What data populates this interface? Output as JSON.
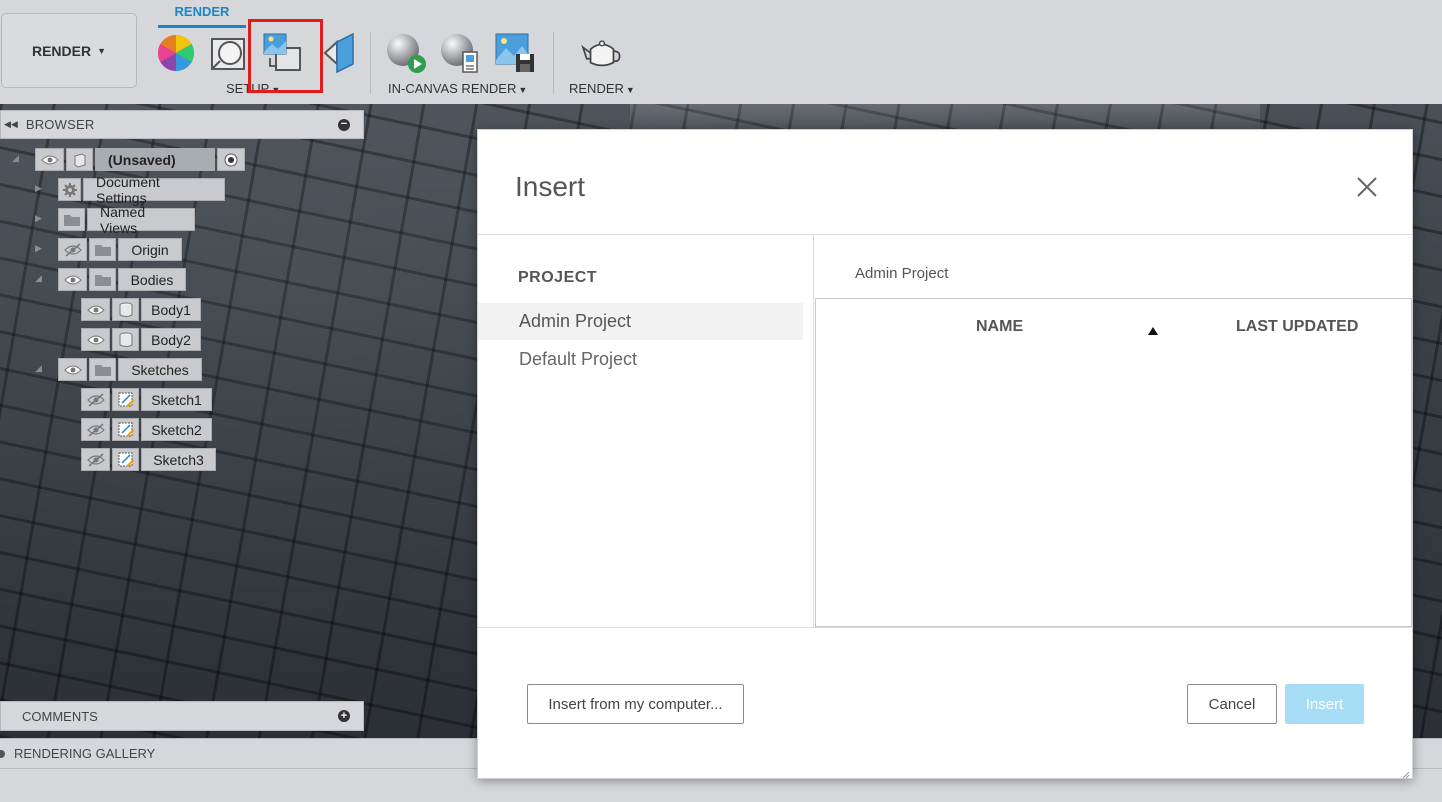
{
  "toolbar": {
    "workspace_label": "RENDER",
    "active_tab": "RENDER",
    "groups": {
      "setup": "SETUP",
      "in_canvas_render": "IN-CANVAS RENDER",
      "render": "RENDER"
    },
    "tools": [
      "appearance-icon",
      "scene-settings-icon",
      "texture-map-icon",
      "decal-icon",
      "in-canvas-render-icon",
      "in-canvas-render-settings-icon",
      "capture-image-icon",
      "render-teapot-icon"
    ],
    "highlight_color": "#e21b1b",
    "accent_color": "#1a86c9"
  },
  "browser": {
    "title": "BROWSER",
    "root": {
      "label": "(Unsaved)"
    },
    "items": [
      {
        "label": "Document Settings"
      },
      {
        "label": "Named Views"
      },
      {
        "label": "Origin"
      },
      {
        "label": "Bodies"
      },
      {
        "label": "Body1"
      },
      {
        "label": "Body2"
      },
      {
        "label": "Sketches"
      },
      {
        "label": "Sketch1"
      },
      {
        "label": "Sketch2"
      },
      {
        "label": "Sketch3"
      }
    ]
  },
  "comments": {
    "title": "COMMENTS"
  },
  "gallery": {
    "title": "RENDERING GALLERY"
  },
  "dialog": {
    "title": "Insert",
    "project_heading": "PROJECT",
    "projects": [
      "Admin Project",
      "Default Project"
    ],
    "selected_project": "Admin Project",
    "breadcrumb": "Admin Project",
    "columns": {
      "name": "NAME",
      "last_updated": "LAST UPDATED"
    },
    "rows": [],
    "buttons": {
      "insert_from_computer": "Insert from my computer...",
      "cancel": "Cancel",
      "insert": "Insert"
    },
    "insert_disabled_color": "#a7dcf5"
  }
}
